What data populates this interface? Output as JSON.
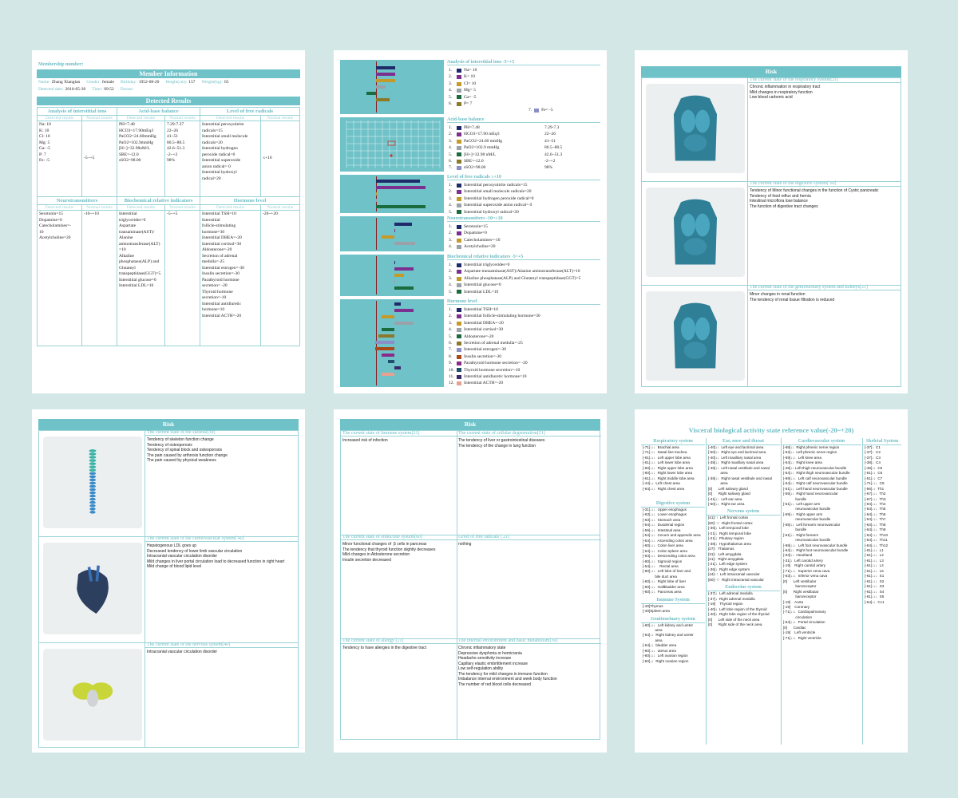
{
  "page1": {
    "membership_label": "Membership number:",
    "member_info_title": "Member Information",
    "info": [
      {
        "label": "Name:",
        "value": "Zhang Xianglan"
      },
      {
        "label": "Gender:",
        "value": "female"
      },
      {
        "label": "Birthday:",
        "value": "1952-08-20"
      },
      {
        "label": "Height(cm):",
        "value": "157"
      },
      {
        "label": "Weight(kg):",
        "value": "65"
      }
    ],
    "info2": [
      {
        "label": "Detected date:",
        "value": "2016-05-30"
      },
      {
        "label": "Time:",
        "value": "09:52"
      },
      {
        "label": "Doctor:",
        "value": ""
      }
    ],
    "detected_title": "Detected Results",
    "sec_a": [
      "Analysis of interstitial ions",
      "Acid-base balance",
      "Level of free radicals"
    ],
    "sec_b": [
      "Neurotransmitters",
      "Biochemical relative indicators",
      "Hormone level"
    ],
    "col_detected": "Detected results",
    "col_normal": "Normal results",
    "ions": "Na: 10\nK: 10\nCl: 10\nMg: 5\nGa: -5\nP: 7\nFe: -5",
    "ions_normal": "-5~+5",
    "acid": "PH=7.48\nHCO3=17.90mEq/l\nPaCO2=24.60mmHg\nPaO2=102.9mmHg\n[H+]=32.98nM/L\nSBE=-12.0\nsSO2=98.00",
    "acid_normal": "7.29-7.37\n22~26\n41~51\n80.5~88.5\n42.6~51.3\n-2~+2\n98%",
    "radicals": "Interstitial peroxynitrite\nradicals=15\nInterstitial small molecule\nradicals=20\nInterstitial hydrogen\nperoxide radical=0\nInterstitial superoxide\nanion radical= 0\nInterstitial hydroxyl\nradical=20",
    "radicals_normal": "≤+10",
    "neuro": "Serotonin=15\nDopamine=0\nCatecholamines=-\n10\nAcetylcholine=20",
    "neuro_normal": "-10~+10",
    "bio": "Interstitial\ntriglycerides=0\nAspartate\ntransaminase(AST)/\nAlanine\naminotransferase(ALT)\n=10\nAlkaline\nphosphatase(ALP) and\nGlutamyl\ntranspeptidase(GGT)=5\nInterstitial glucose=0\nInterstitial LDL=10",
    "bio_normal": "-5~+5",
    "hormone": "Interstitial TSH=10\nInterstitial\nfollicle-stimulating\nhormone=30\nInterstitial DHEA=-20\nInterstitial cortisol=30\nAldosterone=-20\nSecretion of adrenal\nmedulla=-25\nInterstitial estrogen=-30\nInsulin secretion=-30\nParathyroid hormone\nsecretion= -20\nThyroid hormone\nsecretion=-10\nInterstitial antidiuretic\nhormone=10\nInterstitial ACTH=-20",
    "hormone_normal": "-20~+20"
  },
  "page2": {
    "ions_title": "Analysis of interstitial ions -5~+5",
    "ions_list": [
      "Na=   10",
      "K=   10",
      "Cl=   10",
      "Mg=   5",
      "Ga=   -5",
      "P=   7"
    ],
    "ions_extra_num": "7.",
    "ions_extra": "Fe=   -5",
    "acid_title": "Acid-base balance",
    "acid_list": [
      {
        "k": "PH=7.48",
        "n": "7.29-7.3"
      },
      {
        "k": "HCO3=17.90   mEq/l",
        "n": "22~26"
      },
      {
        "k": "PaCO2=24.60   mmHg",
        "n": "41~51"
      },
      {
        "k": "PaO2=102.9   mmHg",
        "n": "80.5~88.5"
      },
      {
        "k": "[H+]=32.98   nM/L",
        "n": "42.6~51.3"
      },
      {
        "k": "SBE=-12.0",
        "n": "-2~+2"
      },
      {
        "k": "sSO2=98.00",
        "n": "98%"
      }
    ],
    "rad_title": "Level of free radicals   ≤+10",
    "rad_list": [
      "Interstitial peroxynitrite radicals=15",
      "Interstitial small molecule radicals=20",
      "Interstitial hydrogen peroxide radical=0",
      "Interstitial superoxide anion radical= 0",
      "Interstitial hydroxyl radical=20"
    ],
    "neuro_title": "Neurotransmitters -10~+10",
    "neuro_list": [
      "Serotonin=15",
      "Dopamine=0",
      "Catecholamines=-10",
      "Acetylcholine=20"
    ],
    "bio_title": "Biochemical relative indicators -5~+5",
    "bio_list": [
      "Interstitial triglycerides=0",
      "Aspartate transaminase(AST)/Alanine aminotransferase(ALT)=10",
      "Alkaline phosphatase(ALP) and Glutamyl transpeptidase(GGT)=5",
      "Interstitial glucose=0",
      "Interstitial LDL=10"
    ],
    "hormone_title": "Hormone level",
    "hormone_list": [
      "Interstitial TSH=10",
      "Interstitial follicle-stimulating hormone=30",
      "Interstitial DHEA=-20",
      "Interstitial cortisol=30",
      "Aldosterone=-20",
      "Secretion of adrenal medulla=-25",
      "Interstitial estrogen=-30",
      "Insulin secretion=-30",
      "Parathyroid hormone secretion= -20",
      "Thyroid hormone secretion=-10",
      "Interstitial antidiuretic hormone=10",
      "Interstitial ACTH=-20"
    ],
    "colors": [
      "#1f2a6b",
      "#7b2f8f",
      "#c49a2a",
      "#9aa1a8",
      "#1a6b3d",
      "#8a7a2a",
      "#8a8fc8",
      "#a84a1a",
      "#8a2a8a",
      "#1f4f6b",
      "#3a2a6b",
      "#e8a090"
    ]
  },
  "page3": {
    "title": "Risk",
    "sections": [
      {
        "h": "The current state of the respiratory system[21]",
        "t": "Chronic inflammation in respiratory tract\nMild changes in respiratory function\nLow blood carbonic acid"
      },
      {
        "h": "The current state of the digestive system[ 60]",
        "t": "Tendency of Minor functional changes in the function of Cystic pancreatic\nTendency of food reflux and hernia\nIntestinal microflora lose balance\nThe function of digestive tract changes"
      },
      {
        "h": "The current state of the genitourinary system and kidneys[21]",
        "t": "Minor changes in renal function\nThe tendency of renal tissue filtration is reduced"
      }
    ]
  },
  "page4": {
    "title": "Risk",
    "sections": [
      {
        "h": "The current state of the skeletal[30]",
        "t": "Tendency of skeleton function change\nTendency of osteoporosis\nTendency of spinal block and osteoporosis\nThe pain caused by arthrosis function change\nThe pain caused by physical weakness"
      },
      {
        "h": "The current state of the cardiovascular system[ 40]",
        "t": "Hepatogenous LDL goes up\nDecreased tendency of lower limb vascular circulation\nIntracranial vascular circulation disorder\nMild changes in liver portal circulation load to decreased function in right heart\nMild change of blood lipid level"
      },
      {
        "h": "The current state of the nervous system[40]",
        "t": "Intracranial vascular circulation disorder"
      }
    ]
  },
  "page5": {
    "title": "Risk",
    "cells": [
      {
        "h": "The current state of Immune system[21]",
        "t": "Increased risk of infection"
      },
      {
        "h": "The current state of cellular degeneration[21]",
        "t": "The tendency of liver or gastrointestinal diseases\nThe tendency of the change in lung function"
      },
      {
        "h": "The current state of endocrine system[60]",
        "t": "Minor functional changes of  β cells in pancreas\nThe tendency that thyroid function slightly decreases\nMild changes in Aldosterone secretion\nInsulin secretion decreased"
      },
      {
        "h": "Level of free radicals [ 21]",
        "t": "nothing"
      },
      {
        "h": "The current state of allergy [21]",
        "t": "Tendency to have allergies in the digestive tract"
      },
      {
        "h": "The internal environment and basic metabolism[30]",
        "t": "Chronic inflammatory state\nDepressive dysphoria or hemicrania\nHeadache sensitivity increase\nCapillary elastic embrittlement increase\nLow self-regulation ability\nThe tendency for mild changes in immune function\nImbalance internal environment and week body function\nThe number of red blood cells decreased"
      }
    ]
  },
  "page6": {
    "title": "Visceral biological activity state reference value(-20~+20)",
    "respiratory_h": "Respiratory system",
    "respiratory": [
      "[-71]↓↓↓  Brachial area",
      "[-71]↓↓↓  Nasal line trachea",
      "[-61]↓↓↓  Left upper lobe area",
      "[-51]↓↓↓  Left lower lobe area",
      "[-60]↓↓↓  Right upper lobe area",
      "[-60]↓↓↓  Right lower lobe area",
      "[-61]↓↓↓  Right middle lobe area",
      "[-44]↓↓  Left chest area",
      "[-64]↓↓↓  Right chest area"
    ],
    "digestive_h": "Digestive system",
    "digestive": [
      "[-31]↓↓↓  Upper esophagus",
      "[-63]↓↓↓  Lower esophagus",
      "[-63]↓↓↓  Stomach area",
      "[-54]↓↓↓  Duodenal region",
      "[-59]↓↓↓  Intestinal area",
      "[-54]↓↓↓  Cecum and appendix area",
      "[-54]↓↓↓  Ascending colon area",
      "[-60]↓↓↓  Colon liver area",
      "[-64]↓↓↓  Colon spleen area",
      "[-64]↓↓↓  Descending colon area",
      "[-60]↓↓↓  Sigmoid region",
      "[-54]↓↓↓    Rectal area",
      "[-60]↓↓↓  Left lobe of liver and",
      "            bile duct area",
      "[-60]↓↓↓  Right lobe of liver",
      "[-60]↓↓↓  Gallbladder area",
      "[-60]↓↓↓  Pancreas area"
    ],
    "immune_h": "Immune System",
    "immune": [
      "[-40]Thymus",
      "[-40]Spleen area"
    ],
    "geni_h": "Genitourinary system",
    "geni": [
      "[-60]↓↓↓  Left kidney and ureter",
      "            area",
      "[-54]↓↓  Right kidney and ureter",
      "            area",
      "[-54]↓↓  bladder area",
      "[-60]↓↓↓  uterus area",
      "[-60]↓↓↓  Left ovarian region",
      "[-50]↓↓  Right ovarian region"
    ],
    "ent_h": "Ear, nose and throat",
    "ent": [
      "[-40]↓↓  Left eye and lacrimal area",
      "[-50]↓↓  Right eye and lacrimal area",
      "[-40]↓↓  Left maxillary nasal area",
      "[-38]↓↓  Right maxillary nasal area",
      "[-45]↓↓  Left nasal vestibule and nasal",
      "            area",
      "[-38]↓↓  Right nasal vestibule and nasal",
      "            area",
      "[0]      Left salivary gland",
      "[0]      Right salivary gland",
      "[-41]↓↓  Left ear area",
      "[-50]↓↓  Right ear area"
    ],
    "nervous_h": "Nervous system",
    "nervous": [
      "[41]↑↑  Left frontal cortex",
      "[60]↑↑↑  Right frontal cortex",
      "[-36]↓  Left temporal lobe",
      "[-21]↓  Right temporal lobe",
      "[-21]↓  Pituitary region",
      "[-38]↓  Hypothalamus area",
      "[27]↑  Thalamus",
      "[31]↑  Left amygdala",
      "[21]↑  Right amygdala",
      "[-21]↓  Left edge system",
      "[-36]↓  Right edge system",
      "[44]↑↑  Left intracranial vascular",
      "[60]↑↑↑  Right intracranial vascular"
    ],
    "endocrine_h": "Endocrine system",
    "endocrine": [
      "[-37]↓  Left adrenal medulla",
      "[-37]↓  Right adrenal medulla",
      "[-19]    Thyroid region",
      "[-40]↓  Left lobe region of the thyroid",
      "[-40]↓  Right lobe region of the thyroid",
      "[0]      Left side of the neck area",
      "[0]      Right side of the neck area"
    ],
    "cardio_h": "Cardiovascular system",
    "cardio": [
      "[-68]↓↓  Right phrenic nerve region",
      "[-52]↓↓  Left phrenic nerve region",
      "[-69]↓↓↓  Left knee area",
      "[-54]↓↓  Right knee area",
      "[-48]↓↓ Left thigh neurovascular bundle",
      "[-54]↓↓  Right thigh neurovascular bundle",
      "[-69]↓↓↓  Left calf neurovascular bundle",
      "[-54]↓↓  Right calf neurovascular bundle",
      "[-51]↓↓  Left hand neurovascular bundle",
      "[-55]↓↓  Right hand neurovascular",
      "            bundle",
      "[-51]↓↓  Left upper arm",
      "            neurovascular bundle",
      "[-59]↓↓  Right upper arm",
      "            neurovascular bundle",
      "[-55]↓↓  Left forearm neurovascular",
      "            bundle",
      "[-51]↓↓  Right forearm",
      "            neurovascular bundle",
      "[-68]↓↓↓  Left foot neurovascular bundle",
      "[-64]↓↓  Right foot neurovascular bundle",
      "[-63]↓↓  Heartland",
      "[-31]↓  Left carotid artery",
      "[-19]    Right carotid artery",
      "[-71]↓↓↓  Superior vena cava",
      "[-63]↓↓↓  Inferior vena cava",
      "[0]      Left vestibular",
      "            baroreceptor",
      "[0]      Right vestibular",
      "            baroreceptor",
      "[-19]    Aorta",
      "[-19]    Coronary",
      "[-71]↓↓↓  Cardiopulmonary",
      "            circulation",
      "[-64]↓↓↓  Portal circulation",
      "[0]      Cardiac",
      "[-19]    Left ventricle",
      "[-71]↓↓↓  Right ventricle"
    ],
    "skeletal_h": "Skeletal System",
    "skeletal": [
      "[-37]↓  C1",
      "[-37]↓  C2",
      "[-37]↓  C3",
      "[-38]↓  C4",
      "[-46]↓↓  C5",
      "[-51]↓↓  C6",
      "[-51]↓↓  C7",
      "[-71]↓↓↓  C8",
      "[-56]↓↓  Th1",
      "[-67]↓↓↓  Th2",
      "[-67]↓↓↓  Th3",
      "[-64]↓↓↓  Th4",
      "[-64]↓↓↓  Th5",
      "[-64]↓↓↓  Th6",
      "[-64]↓↓↓  Th7",
      "[-64]↓↓↓  Th8",
      "[-64]↓↓↓  Th9",
      "[-64]↓↓↓  Th10",
      "[-64]↓↓↓  Th11",
      "[-64]↓↓↓  Th12",
      "[-61]↓↓↓  L1",
      "[-61]↓↓↓  L2",
      "[-61]↓↓↓  L3",
      "[-61]↓↓↓  L4",
      "[-61]↓↓↓  L5",
      "[-61]↓↓↓  S1",
      "[-61]↓↓↓  S2",
      "[-61]↓↓↓  S3",
      "[-61]↓↓↓  S4",
      "[-61]↓↓↓  S5",
      "[-54]↓↓  Cc1"
    ]
  }
}
